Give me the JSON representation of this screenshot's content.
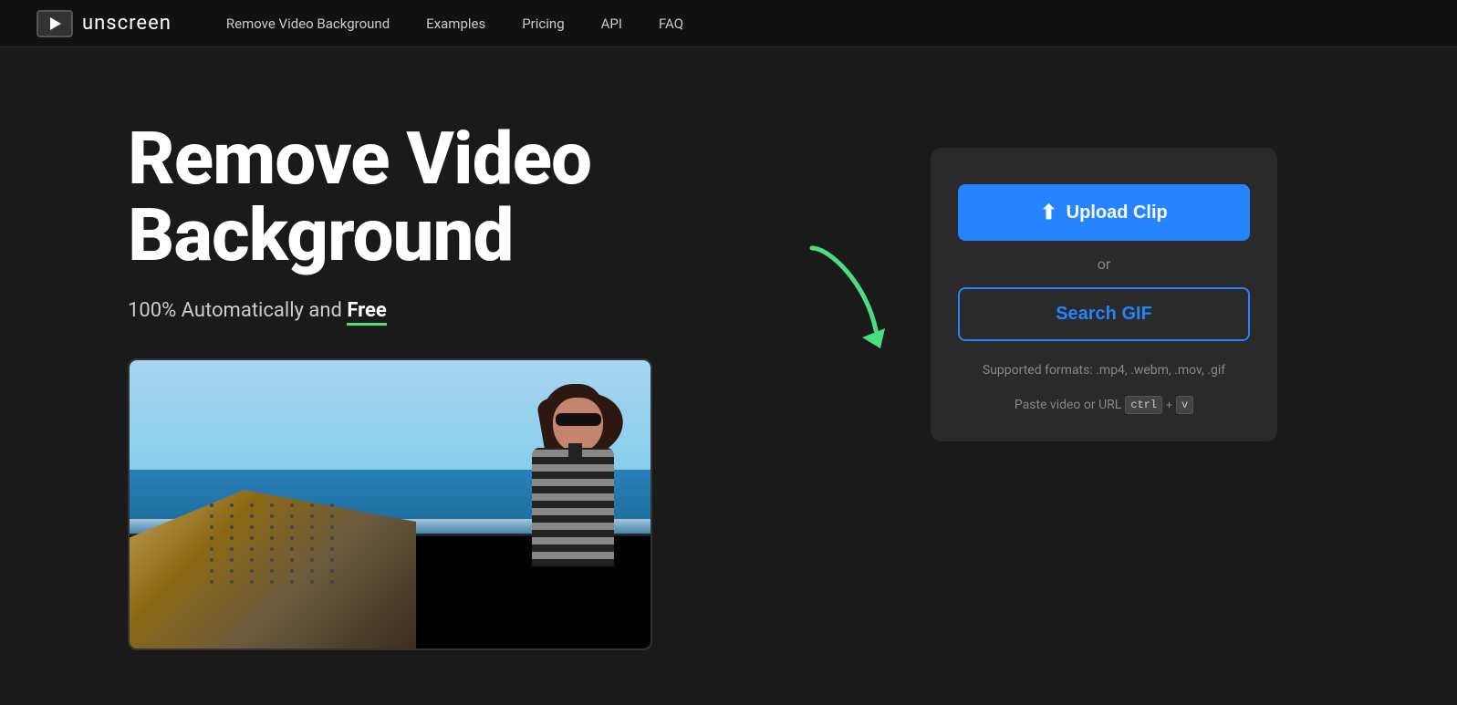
{
  "navbar": {
    "logo_text": "unscreen",
    "links": [
      {
        "label": "Remove Video Background",
        "href": "#"
      },
      {
        "label": "Examples",
        "href": "#"
      },
      {
        "label": "Pricing",
        "href": "#"
      },
      {
        "label": "API",
        "href": "#"
      },
      {
        "label": "FAQ",
        "href": "#"
      }
    ]
  },
  "hero": {
    "title_line1": "Remove Video",
    "title_line2": "Background",
    "subtitle_plain": "100% Automatically and ",
    "subtitle_bold": "Free"
  },
  "upload_panel": {
    "upload_btn_label": "Upload Clip",
    "or_text": "or",
    "search_gif_label": "Search GIF",
    "supported_formats_label": "Supported formats: .mp4, .webm, .mov, .gif",
    "paste_hint": "Paste video or URL",
    "ctrl_key": "ctrl",
    "v_key": "v"
  },
  "colors": {
    "accent_blue": "#2684ff",
    "accent_green": "#4ade80",
    "bg_dark": "#1a1a1a",
    "bg_panel": "#2a2a2a",
    "bg_nav": "#111111"
  },
  "icons": {
    "upload": "⬆"
  }
}
